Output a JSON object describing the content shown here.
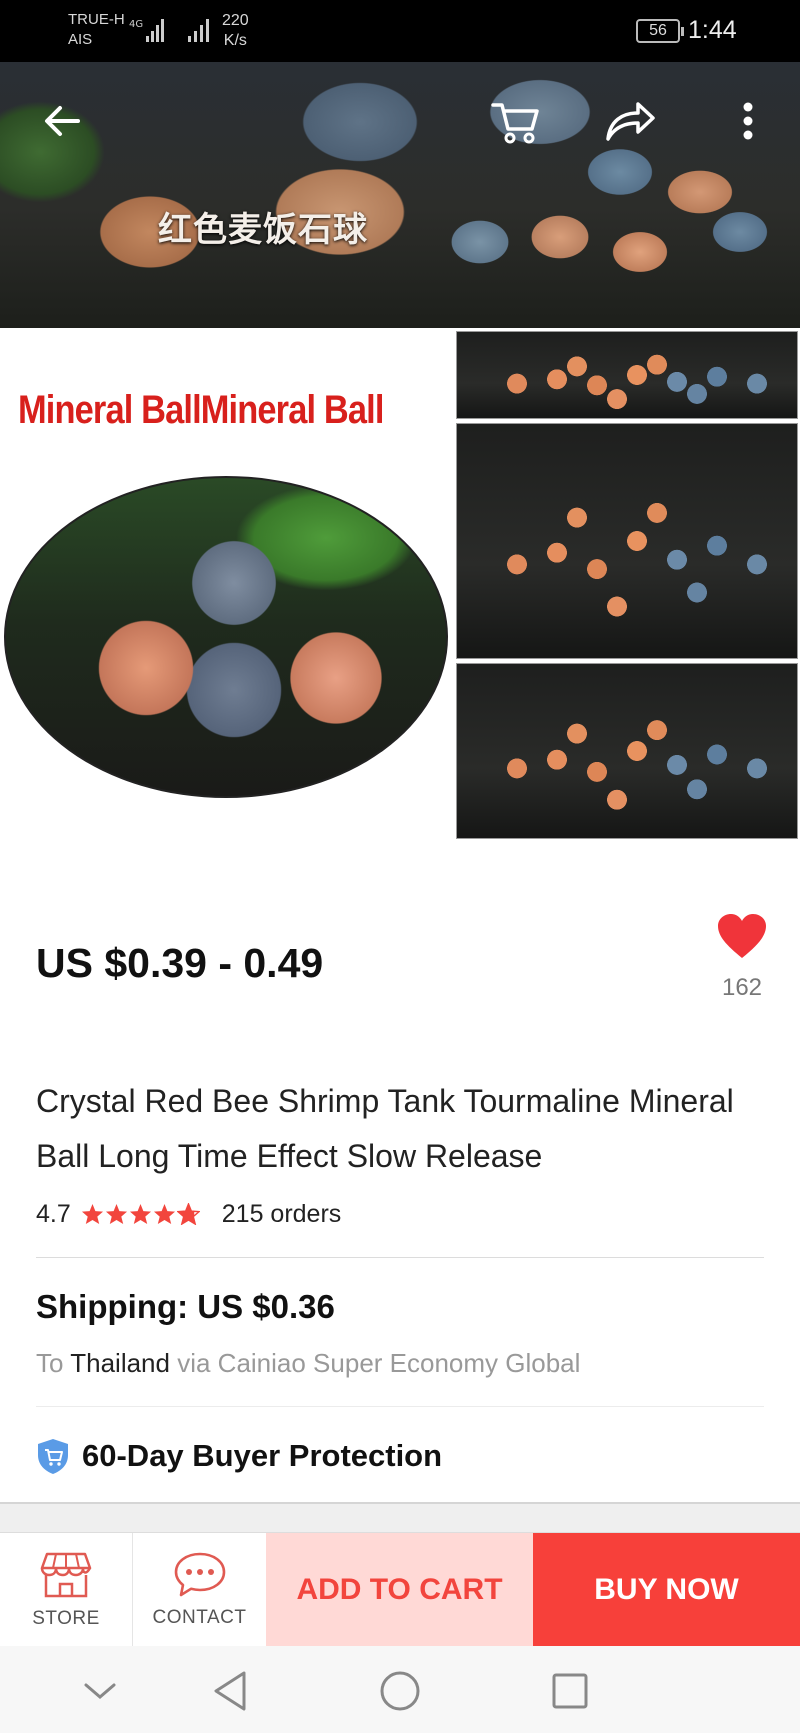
{
  "status_bar": {
    "carrier_line1": "TRUE-H",
    "carrier_line2": "AIS",
    "network_type": "4G",
    "speed_value": "220",
    "speed_unit": "K/s",
    "battery": "56",
    "time": "1:44"
  },
  "hero": {
    "overlay_text": "红色麦饭石球"
  },
  "collage": {
    "title": "Mineral BallMineral Ball"
  },
  "product": {
    "price": "US $0.39 - 0.49",
    "wishlist_count": "162",
    "title": "Crystal Red Bee Shrimp Tank Tourmaline Mineral Ball Long Time Effect Slow Release",
    "rating": "4.7",
    "rating_stars": 4.7,
    "orders": "215 orders"
  },
  "shipping": {
    "title": "Shipping: US $0.36",
    "to_prefix": "To",
    "destination": "Thailand",
    "method": "via Cainiao Super Economy Global"
  },
  "protection": {
    "label": "60-Day Buyer Protection"
  },
  "action_bar": {
    "store_label": "STORE",
    "contact_label": "CONTACT",
    "add_to_cart_label": "ADD TO CART",
    "buy_now_label": "BUY NOW"
  },
  "colors": {
    "accent": "#f7403a",
    "add_to_cart_bg": "#ffd9d6",
    "star": "#f2453d"
  }
}
